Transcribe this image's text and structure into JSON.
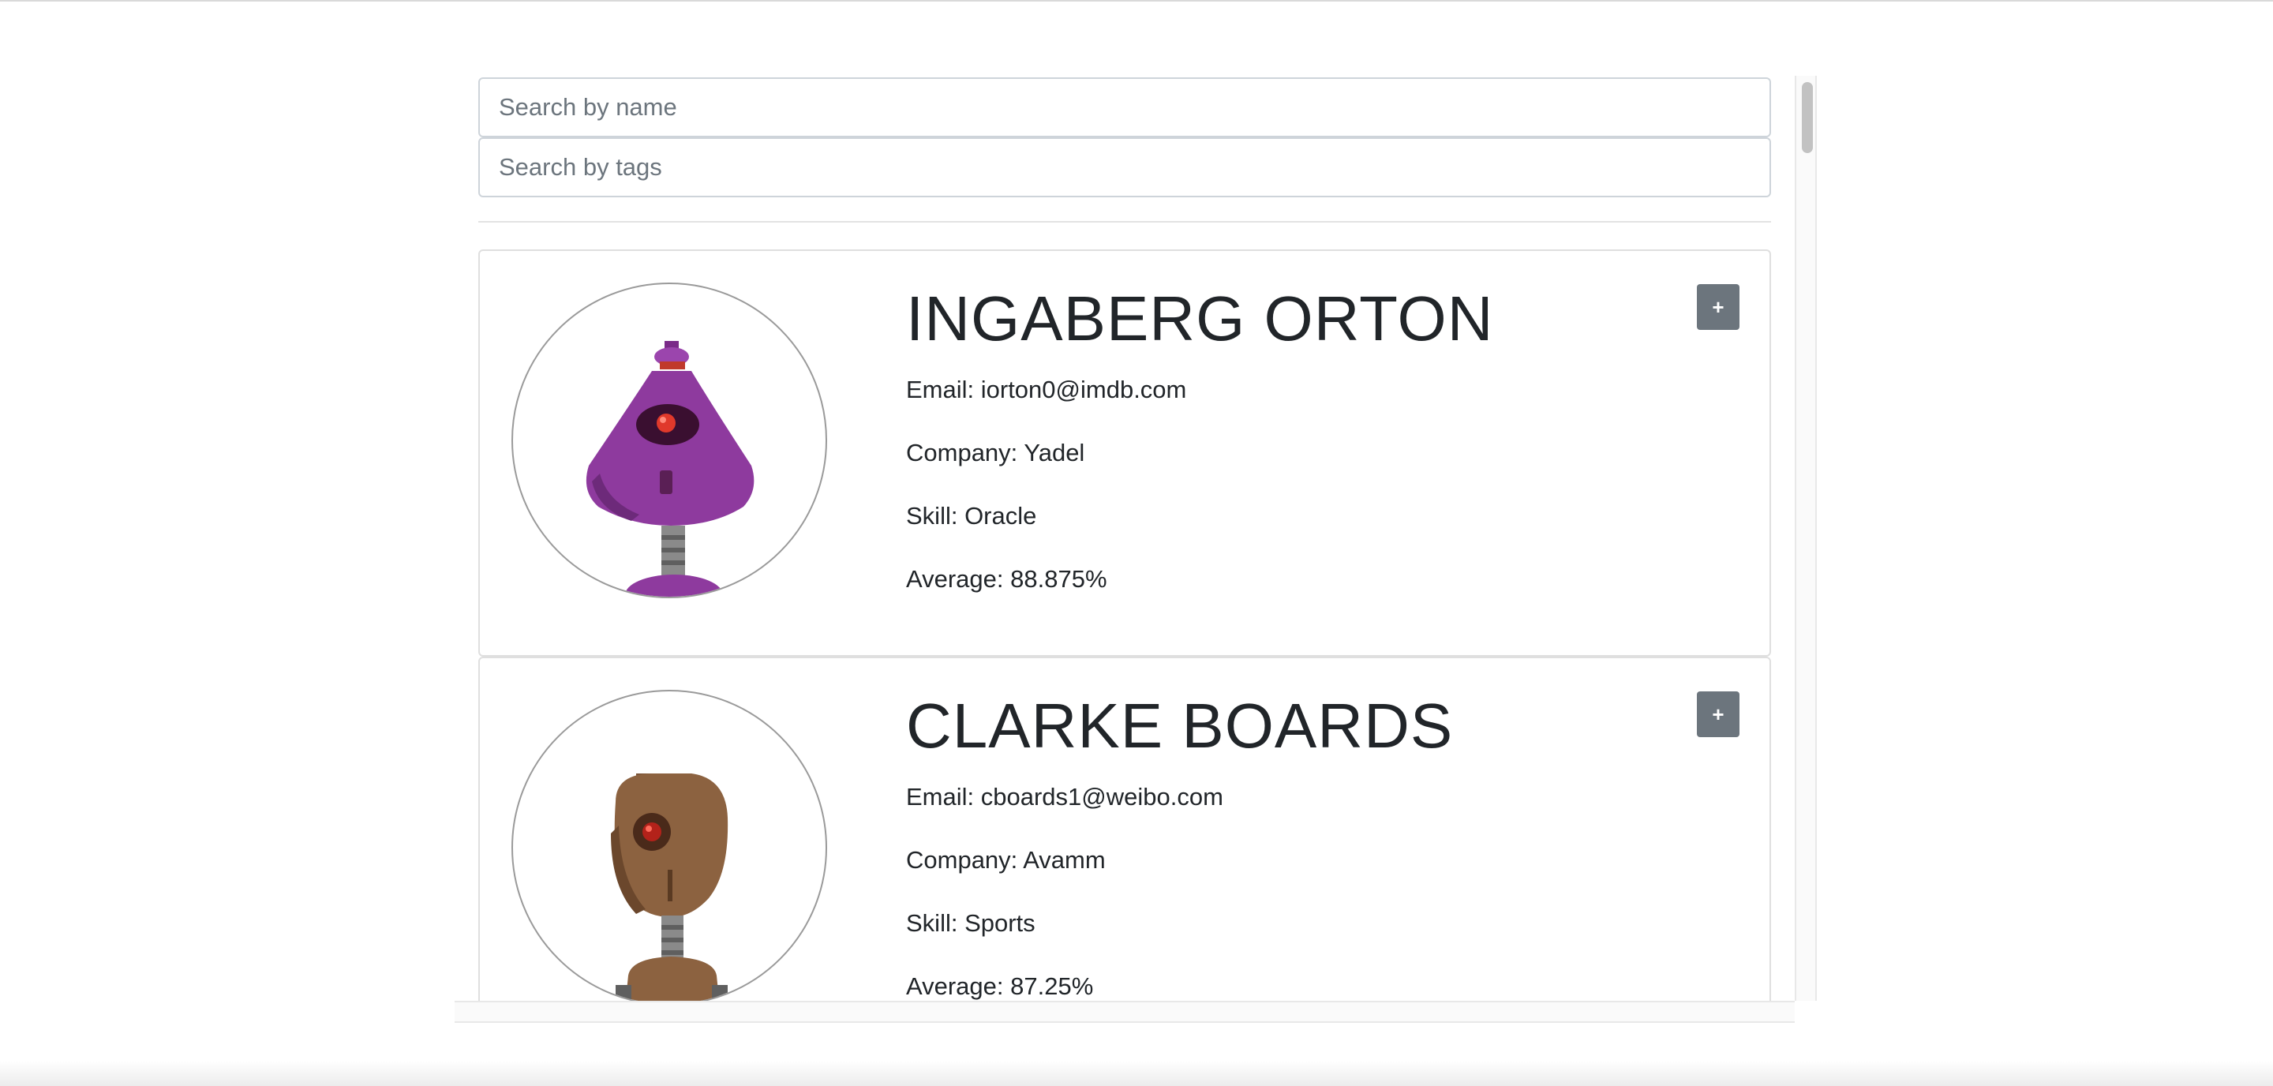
{
  "search": {
    "name_placeholder": "Search by name",
    "tags_placeholder": "Search by tags"
  },
  "students": [
    {
      "name": "INGABERG ORTON",
      "email": "Email: iorton0@imdb.com",
      "company": "Company: Yadel",
      "skill": "Skill: Oracle",
      "average": "Average: 88.875%",
      "expand_label": "+",
      "avatar_icon": "purple-robot-icon",
      "avatar_color": "#8e3a9e"
    },
    {
      "name": "CLARKE BOARDS",
      "email": "Email: cboards1@weibo.com",
      "company": "Company: Avamm",
      "skill": "Skill: Sports",
      "average": "Average: 87.25%",
      "expand_label": "+",
      "avatar_icon": "brown-robot-icon",
      "avatar_color": "#8c6240"
    }
  ]
}
